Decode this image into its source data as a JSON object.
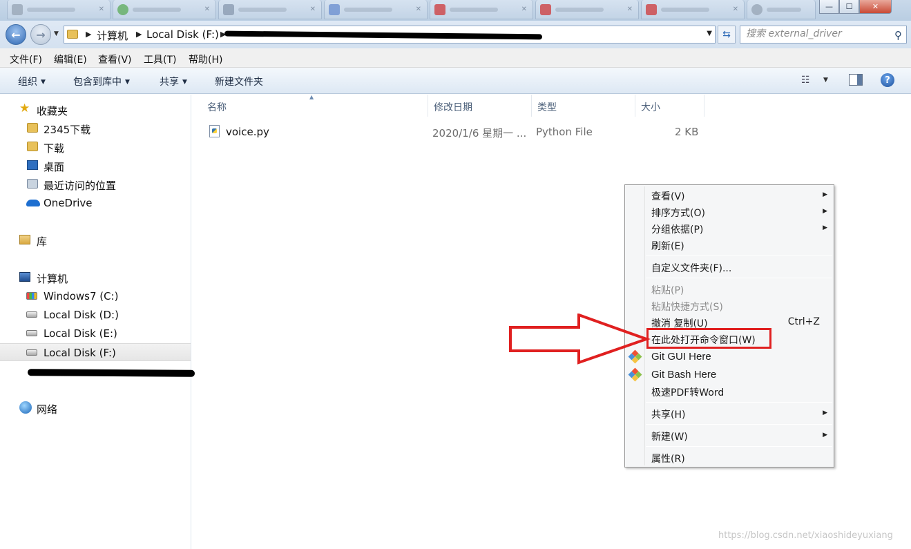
{
  "window": {
    "minimize_glyph": "—",
    "maximize_glyph": "☐",
    "close_glyph": "✕"
  },
  "address_bar": {
    "crumbs": [
      "计算机",
      "Local Disk (F:)"
    ],
    "search_placeholder": "搜索 external_driver"
  },
  "menu_bar": [
    "文件(F)",
    "编辑(E)",
    "查看(V)",
    "工具(T)",
    "帮助(H)"
  ],
  "command_bar": {
    "organize": "组织",
    "include_in_library": "包含到库中",
    "share": "共享",
    "new_folder": "新建文件夹"
  },
  "nav": {
    "favorites": "收藏夹",
    "fav_items": [
      "2345下载",
      "下载",
      "桌面",
      "最近访问的位置",
      "OneDrive"
    ],
    "libraries": "库",
    "computer": "计算机",
    "drives": [
      "Windows7 (C:)",
      "Local Disk (D:)",
      "Local Disk (E:)",
      "Local Disk (F:)"
    ],
    "network": "网络"
  },
  "columns": [
    "名称",
    "修改日期",
    "类型",
    "大小"
  ],
  "files": [
    {
      "name": "voice.py",
      "date": "2020/1/6 星期一 ...",
      "type": "Python File",
      "size": "2 KB"
    }
  ],
  "context_menu": {
    "view": "查看(V)",
    "sort_by": "排序方式(O)",
    "group_by": "分组依据(P)",
    "refresh": "刷新(E)",
    "customize_folder": "自定义文件夹(F)...",
    "paste": "粘贴(P)",
    "paste_shortcut": "粘贴快捷方式(S)",
    "undo_copy": "撤消 复制(U)",
    "undo_shortcut": "Ctrl+Z",
    "open_cmd_here": "在此处打开命令窗口(W)",
    "git_gui": "Git GUI Here",
    "git_bash": "Git Bash Here",
    "pdf_to_word": "极速PDF转Word",
    "share": "共享(H)",
    "new": "新建(W)",
    "properties": "属性(R)"
  },
  "colors": {
    "annotation_red": "#e02020",
    "git_orange": "#f05133",
    "git_green": "#8cc04b",
    "git_blue": "#4a90d9"
  },
  "watermark": "https://blog.csdn.net/xiaoshideyuxiang"
}
